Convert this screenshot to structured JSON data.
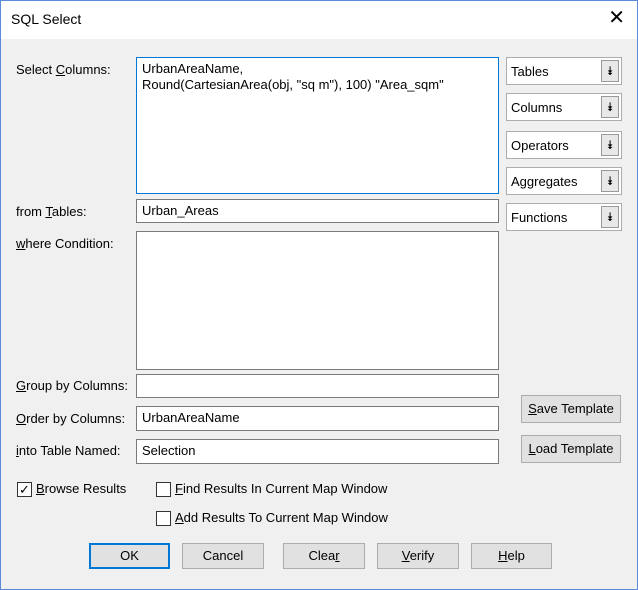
{
  "window": {
    "title": "SQL Select",
    "close_glyph": "✕"
  },
  "labels": {
    "select_columns": [
      "Select ",
      "C",
      "olumns:"
    ],
    "from_tables": [
      "from ",
      "T",
      "ables:"
    ],
    "where_condition": [
      "",
      "w",
      "here Condition:"
    ],
    "group_by": [
      "",
      "G",
      "roup by Columns:"
    ],
    "order_by": [
      "",
      "O",
      "rder by Columns:"
    ],
    "into_table": [
      "",
      "i",
      "nto Table Named:"
    ]
  },
  "fields": {
    "select_columns": "UrbanAreaName,\nRound(CartesianArea(obj, \"sq m\"), 100) \"Area_sqm\"",
    "from_tables": "Urban_Areas",
    "where_condition": "",
    "group_by": "",
    "order_by": "UrbanAreaName",
    "into_table": "Selection"
  },
  "dropdowns": [
    "Tables",
    "Columns",
    "Operators",
    "Aggregates",
    "Functions"
  ],
  "dropdown_icon": "⯯",
  "template_buttons": {
    "save": [
      "",
      "S",
      "ave Template"
    ],
    "load": [
      "",
      "L",
      "oad Template"
    ]
  },
  "checkboxes": {
    "browse": {
      "label": [
        "",
        "B",
        "rowse Results"
      ],
      "checked": true,
      "mark": "✓"
    },
    "find": {
      "label": [
        "",
        "F",
        "ind Results In Current Map Window"
      ],
      "checked": false,
      "mark": ""
    },
    "add": {
      "label": [
        "",
        "A",
        "dd Results To Current Map Window"
      ],
      "checked": false,
      "mark": ""
    }
  },
  "buttons": {
    "ok": "OK",
    "cancel": "Cancel",
    "clear": [
      "Clea",
      "r",
      ""
    ],
    "verify": [
      "",
      "V",
      "erify"
    ],
    "help": [
      "",
      "H",
      "elp"
    ]
  }
}
